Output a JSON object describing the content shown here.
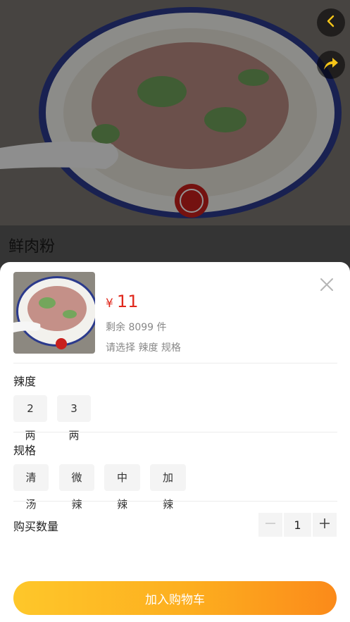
{
  "product": {
    "name": "鲜肉粉",
    "price_symbol": "¥",
    "price": "11",
    "stock_text": "剩余 8099 件",
    "select_hint": "请选择 辣度 规格"
  },
  "sections": {
    "spice": {
      "title": "辣度",
      "options": [
        "2两",
        "3两"
      ]
    },
    "spec": {
      "title": "规格",
      "options": [
        "清汤",
        "微辣",
        "中辣",
        "加辣"
      ]
    }
  },
  "quantity": {
    "label": "购买数量",
    "value": "1"
  },
  "actions": {
    "add_to_cart": "加入购物车"
  },
  "icons": {
    "back": "chevron-left-icon",
    "share": "share-arrow-icon",
    "close": "close-icon",
    "minus": "minus-icon",
    "plus": "plus-icon"
  },
  "colors": {
    "price": "#e0281c",
    "accent_gradient_start": "#fec72a",
    "accent_gradient_end": "#fb8a1a",
    "nav_icon": "#f5c518"
  }
}
